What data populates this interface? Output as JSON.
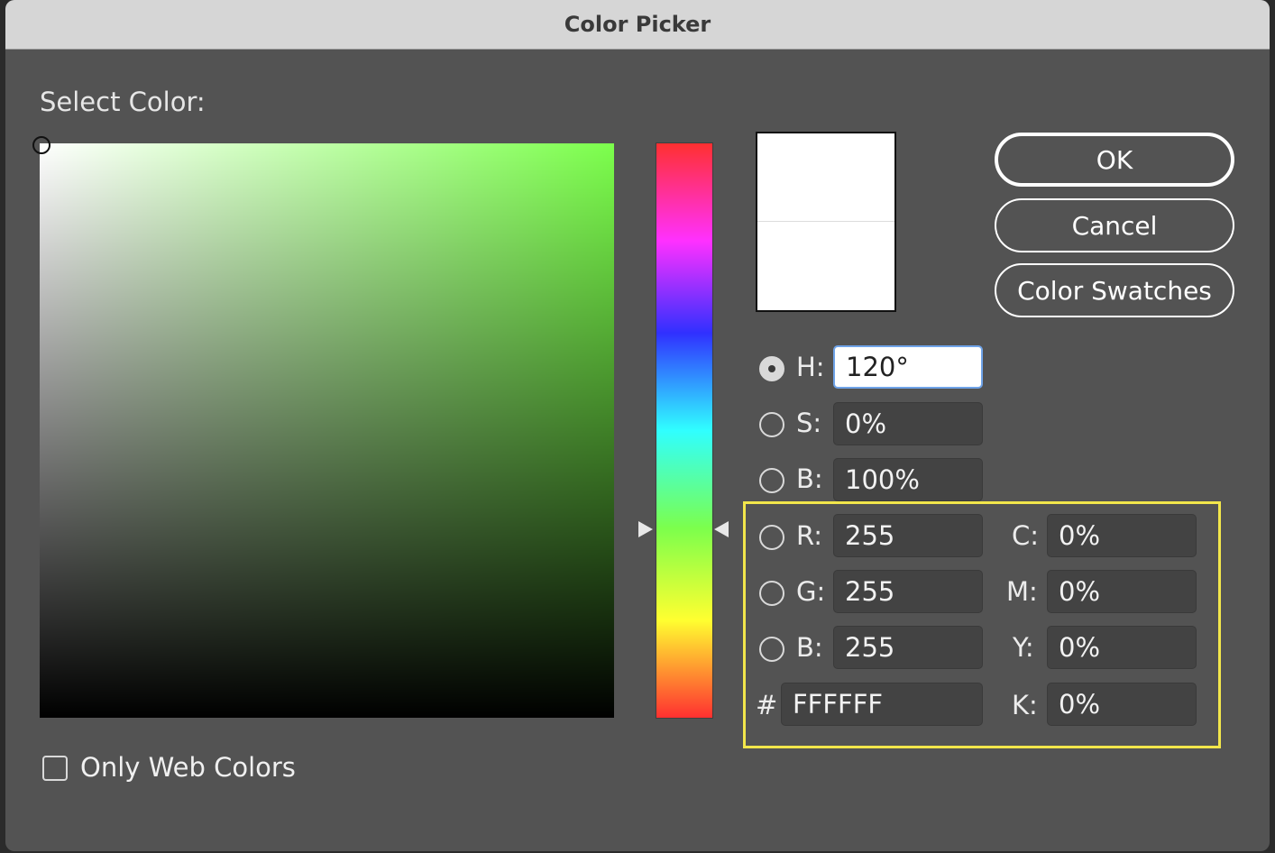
{
  "window": {
    "title": "Color Picker"
  },
  "picker": {
    "select_label": "Select Color:",
    "hue_color": "#7cff4c"
  },
  "preview": {
    "new_color": "#FFFFFF",
    "current_color": "#FFFFFF"
  },
  "buttons": {
    "ok": "OK",
    "cancel": "Cancel",
    "swatches": "Color Swatches"
  },
  "hsb": {
    "h_label": "H:",
    "h_value": "120°",
    "s_label": "S:",
    "s_value": "0%",
    "b_label": "B:",
    "b_value": "100%"
  },
  "rgb": {
    "r_label": "R:",
    "r_value": "255",
    "g_label": "G:",
    "g_value": "255",
    "b_label": "B:",
    "b_value": "255"
  },
  "hex": {
    "label": "#",
    "value": "FFFFFF"
  },
  "cmyk": {
    "c_label": "C:",
    "c_value": "0%",
    "m_label": "M:",
    "m_value": "0%",
    "y_label": "Y:",
    "y_value": "0%",
    "k_label": "K:",
    "k_value": "0%"
  },
  "options": {
    "web_colors_label": "Only Web Colors",
    "web_colors_checked": false
  },
  "highlight_color": "#f2e64b"
}
